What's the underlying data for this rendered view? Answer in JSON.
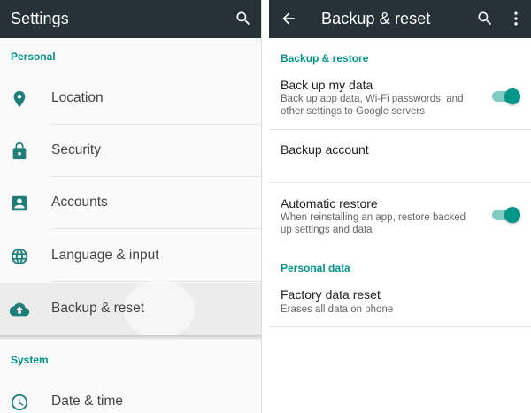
{
  "settings": {
    "title": "Settings",
    "sections": {
      "personal": "Personal",
      "system": "System"
    },
    "items": [
      {
        "label": "Location",
        "icon": "location-pin-icon"
      },
      {
        "label": "Security",
        "icon": "lock-icon"
      },
      {
        "label": "Accounts",
        "icon": "account-box-icon"
      },
      {
        "label": "Language & input",
        "icon": "globe-icon"
      },
      {
        "label": "Backup & reset",
        "icon": "cloud-upload-icon"
      },
      {
        "label": "Date & time",
        "icon": "clock-icon"
      }
    ]
  },
  "backup": {
    "title": "Backup & reset",
    "sections": {
      "backup_restore": "Backup & restore",
      "personal_data": "Personal data"
    },
    "back_up_my_data": {
      "title": "Back up my data",
      "subtitle": "Back up app data, Wi-Fi passwords, and other settings to Google servers",
      "enabled": true
    },
    "backup_account": {
      "title": "Backup account"
    },
    "automatic_restore": {
      "title": "Automatic restore",
      "subtitle": "When reinstalling an app, restore backed up settings and data",
      "enabled": true
    },
    "factory_reset": {
      "title": "Factory data reset",
      "subtitle": "Erases all data on phone"
    }
  },
  "colors": {
    "appbar": "#263238",
    "accent": "#009688",
    "icon": "#1e7f7a"
  }
}
